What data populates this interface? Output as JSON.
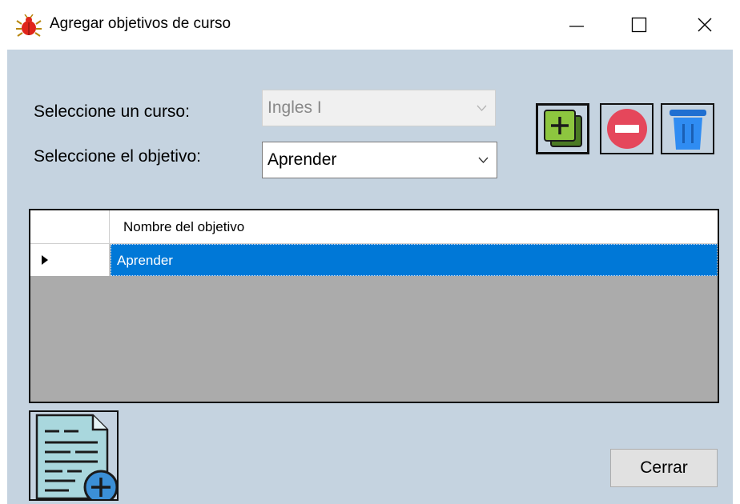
{
  "window": {
    "title": "Agregar objetivos de curso",
    "icon": "bug-icon"
  },
  "form": {
    "curso_label": "Seleccione un curso:",
    "curso_value": "Ingles I",
    "objetivo_label": "Seleccione el objetivo:",
    "objetivo_value": "Aprender"
  },
  "toolbar": {
    "add_icon": "add-square-icon",
    "remove_icon": "remove-circle-icon",
    "delete_icon": "trash-icon"
  },
  "grid": {
    "columns": [
      "Nombre del objetivo"
    ],
    "rows": [
      {
        "nombre": "Aprender",
        "selected": true
      }
    ]
  },
  "footer": {
    "close_label": "Cerrar",
    "add_document_icon": "add-document-icon"
  },
  "colors": {
    "background": "#c5d3e0",
    "selection": "#0078d7",
    "grid_empty": "#ababab"
  }
}
